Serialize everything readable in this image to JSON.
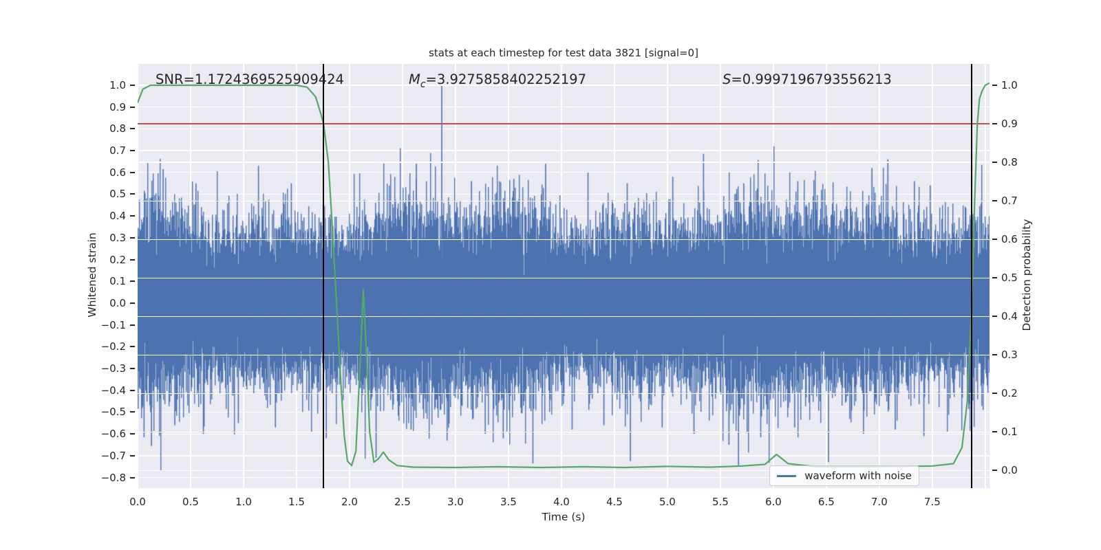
{
  "title": "stats at each timestep for test data 3821 [signal=0]",
  "annotations": {
    "snr": "SNR=1.1724369525909424",
    "mc_symbol": "M",
    "mc_subscript": "c",
    "mc_value": "=3.9275858402252197",
    "s_symbol": "S",
    "s_value": "=0.9997196793556213"
  },
  "legend": {
    "label": "waveform with noise"
  },
  "colors": {
    "background": "#ffffff",
    "axes_background": "#eaeaf2",
    "grid": "#ffffff",
    "waveform": "#4c72b0",
    "detection": "#55a868",
    "threshold": "#c44e52",
    "marker": "#000000",
    "text": "#262626"
  },
  "axes": {
    "x": {
      "label": "Time (s)",
      "min": 0,
      "max": 8.04,
      "tick_values": [
        0,
        0.5,
        1,
        1.5,
        2,
        2.5,
        3,
        3.5,
        4,
        4.5,
        5,
        5.5,
        6,
        6.5,
        7,
        7.5
      ],
      "tick_labels": [
        "0.0",
        "0.5",
        "1.0",
        "1.5",
        "2.0",
        "2.5",
        "3.0",
        "3.5",
        "4.0",
        "4.5",
        "5.0",
        "5.5",
        "6.0",
        "6.5",
        "7.0",
        "7.5"
      ],
      "grid_extra": [
        8.0
      ]
    },
    "y_left": {
      "label": "Whitened strain",
      "min": -0.8487,
      "max": 1.0977,
      "tick_values": [
        1.0,
        0.9,
        0.8,
        0.7,
        0.6,
        0.5,
        0.4,
        0.3,
        0.2,
        0.1,
        0.0,
        -0.1,
        -0.2,
        -0.3,
        -0.4,
        -0.5,
        -0.6,
        -0.7,
        -0.8
      ],
      "tick_labels": [
        "1.0",
        "0.9",
        "0.8",
        "0.7",
        "0.6",
        "0.5",
        "0.4",
        "0.3",
        "0.2",
        "0.1",
        "0.0",
        "−0.1",
        "−0.2",
        "−0.3",
        "−0.4",
        "−0.5",
        "−0.6",
        "−0.7",
        "−0.8"
      ]
    },
    "y_right": {
      "label": "Detection probability",
      "min": -0.0455,
      "max": 1.0553,
      "tick_values": [
        1.0,
        0.9,
        0.8,
        0.7,
        0.6,
        0.5,
        0.4,
        0.3,
        0.2,
        0.1,
        0.0
      ],
      "tick_labels": [
        "1.0",
        "0.9",
        "0.8",
        "0.7",
        "0.6",
        "0.5",
        "0.4",
        "0.3",
        "0.2",
        "0.1",
        "0.0"
      ]
    }
  },
  "chart_data": {
    "type": "line",
    "title": "stats at each timestep for test data 3821 [signal=0]",
    "xlabel": "Time (s)",
    "ylabel_left": "Whitened strain",
    "ylabel_right": "Detection probability",
    "grid": true,
    "legend_position": "lower right",
    "threshold_line": {
      "axis": "right",
      "value": 0.9,
      "color": "#c44e52"
    },
    "vlines": [
      {
        "t": 1.754
      },
      {
        "t": 7.87
      }
    ],
    "series": [
      {
        "name": "waveform with noise",
        "axis": "left",
        "color": "#4c72b0",
        "kind": "dense-gaussian-noise",
        "noise": {
          "seed": 1337,
          "sigma": 0.16,
          "samples_per_column": 22,
          "t_range": [
            0,
            8.04
          ],
          "clip": [
            -0.77,
            0.72
          ]
        },
        "outliers_up": [
          [
            0.24,
            0.615
          ],
          [
            0.55,
            0.55
          ],
          [
            1.14,
            0.63
          ],
          [
            1.45,
            0.55
          ],
          [
            2.63,
            0.64
          ],
          [
            2.87,
            1.0
          ],
          [
            3.15,
            0.56
          ],
          [
            3.55,
            0.57
          ],
          [
            3.85,
            0.64
          ],
          [
            4.25,
            0.6
          ],
          [
            4.62,
            0.55
          ],
          [
            5.05,
            0.58
          ],
          [
            5.34,
            0.685
          ],
          [
            5.72,
            0.55
          ],
          [
            6.23,
            0.56
          ],
          [
            6.93,
            0.62
          ],
          [
            7.08,
            0.66
          ],
          [
            7.33,
            0.56
          ],
          [
            7.48,
            0.54
          ]
        ],
        "outliers_down": [
          [
            0.06,
            -0.615
          ],
          [
            0.13,
            -0.655
          ],
          [
            0.35,
            -0.56
          ],
          [
            0.62,
            -0.6
          ],
          [
            0.95,
            -0.55
          ],
          [
            1.3,
            -0.57
          ],
          [
            1.78,
            -0.62
          ],
          [
            2.25,
            -0.71
          ],
          [
            2.58,
            -0.58
          ],
          [
            2.92,
            -0.63
          ],
          [
            3.28,
            -0.6
          ],
          [
            3.45,
            -0.62
          ],
          [
            3.73,
            -0.735
          ],
          [
            4.1,
            -0.58
          ],
          [
            4.4,
            -0.56
          ],
          [
            4.65,
            -0.725
          ],
          [
            4.95,
            -0.57
          ],
          [
            5.25,
            -0.6
          ],
          [
            5.58,
            -0.65
          ],
          [
            5.67,
            -0.745
          ],
          [
            5.88,
            -0.615
          ],
          [
            6.2,
            -0.57
          ],
          [
            6.52,
            -0.73
          ],
          [
            6.85,
            -0.6
          ],
          [
            7.15,
            -0.58
          ],
          [
            7.42,
            -0.61
          ]
        ]
      },
      {
        "name": "detection probability",
        "axis": "right",
        "color": "#55a868",
        "points": [
          [
            0.0,
            0.955
          ],
          [
            0.05,
            0.99
          ],
          [
            0.12,
            1.0
          ],
          [
            0.2,
            1.0
          ],
          [
            1.5,
            1.0
          ],
          [
            1.6,
            0.995
          ],
          [
            1.68,
            0.97
          ],
          [
            1.73,
            0.925
          ],
          [
            1.755,
            0.9
          ],
          [
            1.8,
            0.8
          ],
          [
            1.84,
            0.62
          ],
          [
            1.88,
            0.42
          ],
          [
            1.92,
            0.22
          ],
          [
            1.95,
            0.09
          ],
          [
            1.98,
            0.025
          ],
          [
            2.02,
            0.013
          ],
          [
            2.06,
            0.05
          ],
          [
            2.1,
            0.28
          ],
          [
            2.13,
            0.47
          ],
          [
            2.16,
            0.3
          ],
          [
            2.19,
            0.1
          ],
          [
            2.23,
            0.022
          ],
          [
            2.27,
            0.03
          ],
          [
            2.32,
            0.048
          ],
          [
            2.37,
            0.028
          ],
          [
            2.45,
            0.013
          ],
          [
            2.6,
            0.009
          ],
          [
            3.0,
            0.008
          ],
          [
            3.4,
            0.01
          ],
          [
            3.8,
            0.008
          ],
          [
            4.2,
            0.01
          ],
          [
            4.6,
            0.008
          ],
          [
            5.0,
            0.011
          ],
          [
            5.4,
            0.009
          ],
          [
            5.7,
            0.012
          ],
          [
            5.92,
            0.016
          ],
          [
            6.03,
            0.042
          ],
          [
            6.14,
            0.018
          ],
          [
            6.4,
            0.01
          ],
          [
            6.8,
            0.01
          ],
          [
            7.2,
            0.011
          ],
          [
            7.5,
            0.012
          ],
          [
            7.7,
            0.018
          ],
          [
            7.78,
            0.06
          ],
          [
            7.83,
            0.18
          ],
          [
            7.87,
            0.42
          ],
          [
            7.9,
            0.7
          ],
          [
            7.925,
            0.9
          ],
          [
            7.945,
            0.965
          ],
          [
            7.97,
            0.985
          ],
          [
            8.0,
            1.0
          ],
          [
            8.035,
            1.005
          ]
        ]
      }
    ]
  }
}
